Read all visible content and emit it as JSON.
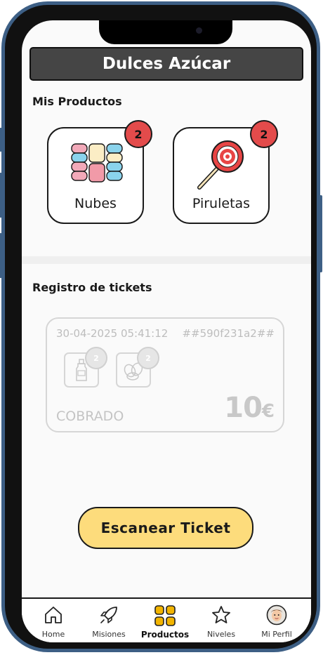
{
  "app": {
    "title": "Dulces Azúcar"
  },
  "products": {
    "section_title": "Mis Productos",
    "items": [
      {
        "label": "Nubes",
        "count": "2",
        "icon": "marshmallow-icon"
      },
      {
        "label": "Piruletas",
        "count": "2",
        "icon": "lollipop-icon"
      }
    ]
  },
  "tickets": {
    "section_title": "Registro de tickets",
    "items": [
      {
        "date": "30-04-2025 05:41:12",
        "id": "##590f231a2##",
        "status": "COBRADO",
        "amount": "10",
        "currency": "€",
        "lines": [
          {
            "icon": "bottle-icon",
            "count": "2"
          },
          {
            "icon": "pastry-icon",
            "count": "2"
          }
        ]
      }
    ]
  },
  "scan_button": {
    "label": "Escanear Ticket"
  },
  "nav": {
    "active": "Productos",
    "items": [
      {
        "label": "Home",
        "icon": "home-icon"
      },
      {
        "label": "Misiones",
        "icon": "rocket-icon"
      },
      {
        "label": "Productos",
        "icon": "grid-icon"
      },
      {
        "label": "Niveles",
        "icon": "star-icon"
      },
      {
        "label": "Mi Perfil",
        "icon": "avatar-icon"
      }
    ]
  },
  "colors": {
    "header_bg": "#454545",
    "badge": "#e34b4b",
    "button": "#fddc7c",
    "frame": "#3d5f85",
    "active_nav": "#f2b400"
  }
}
